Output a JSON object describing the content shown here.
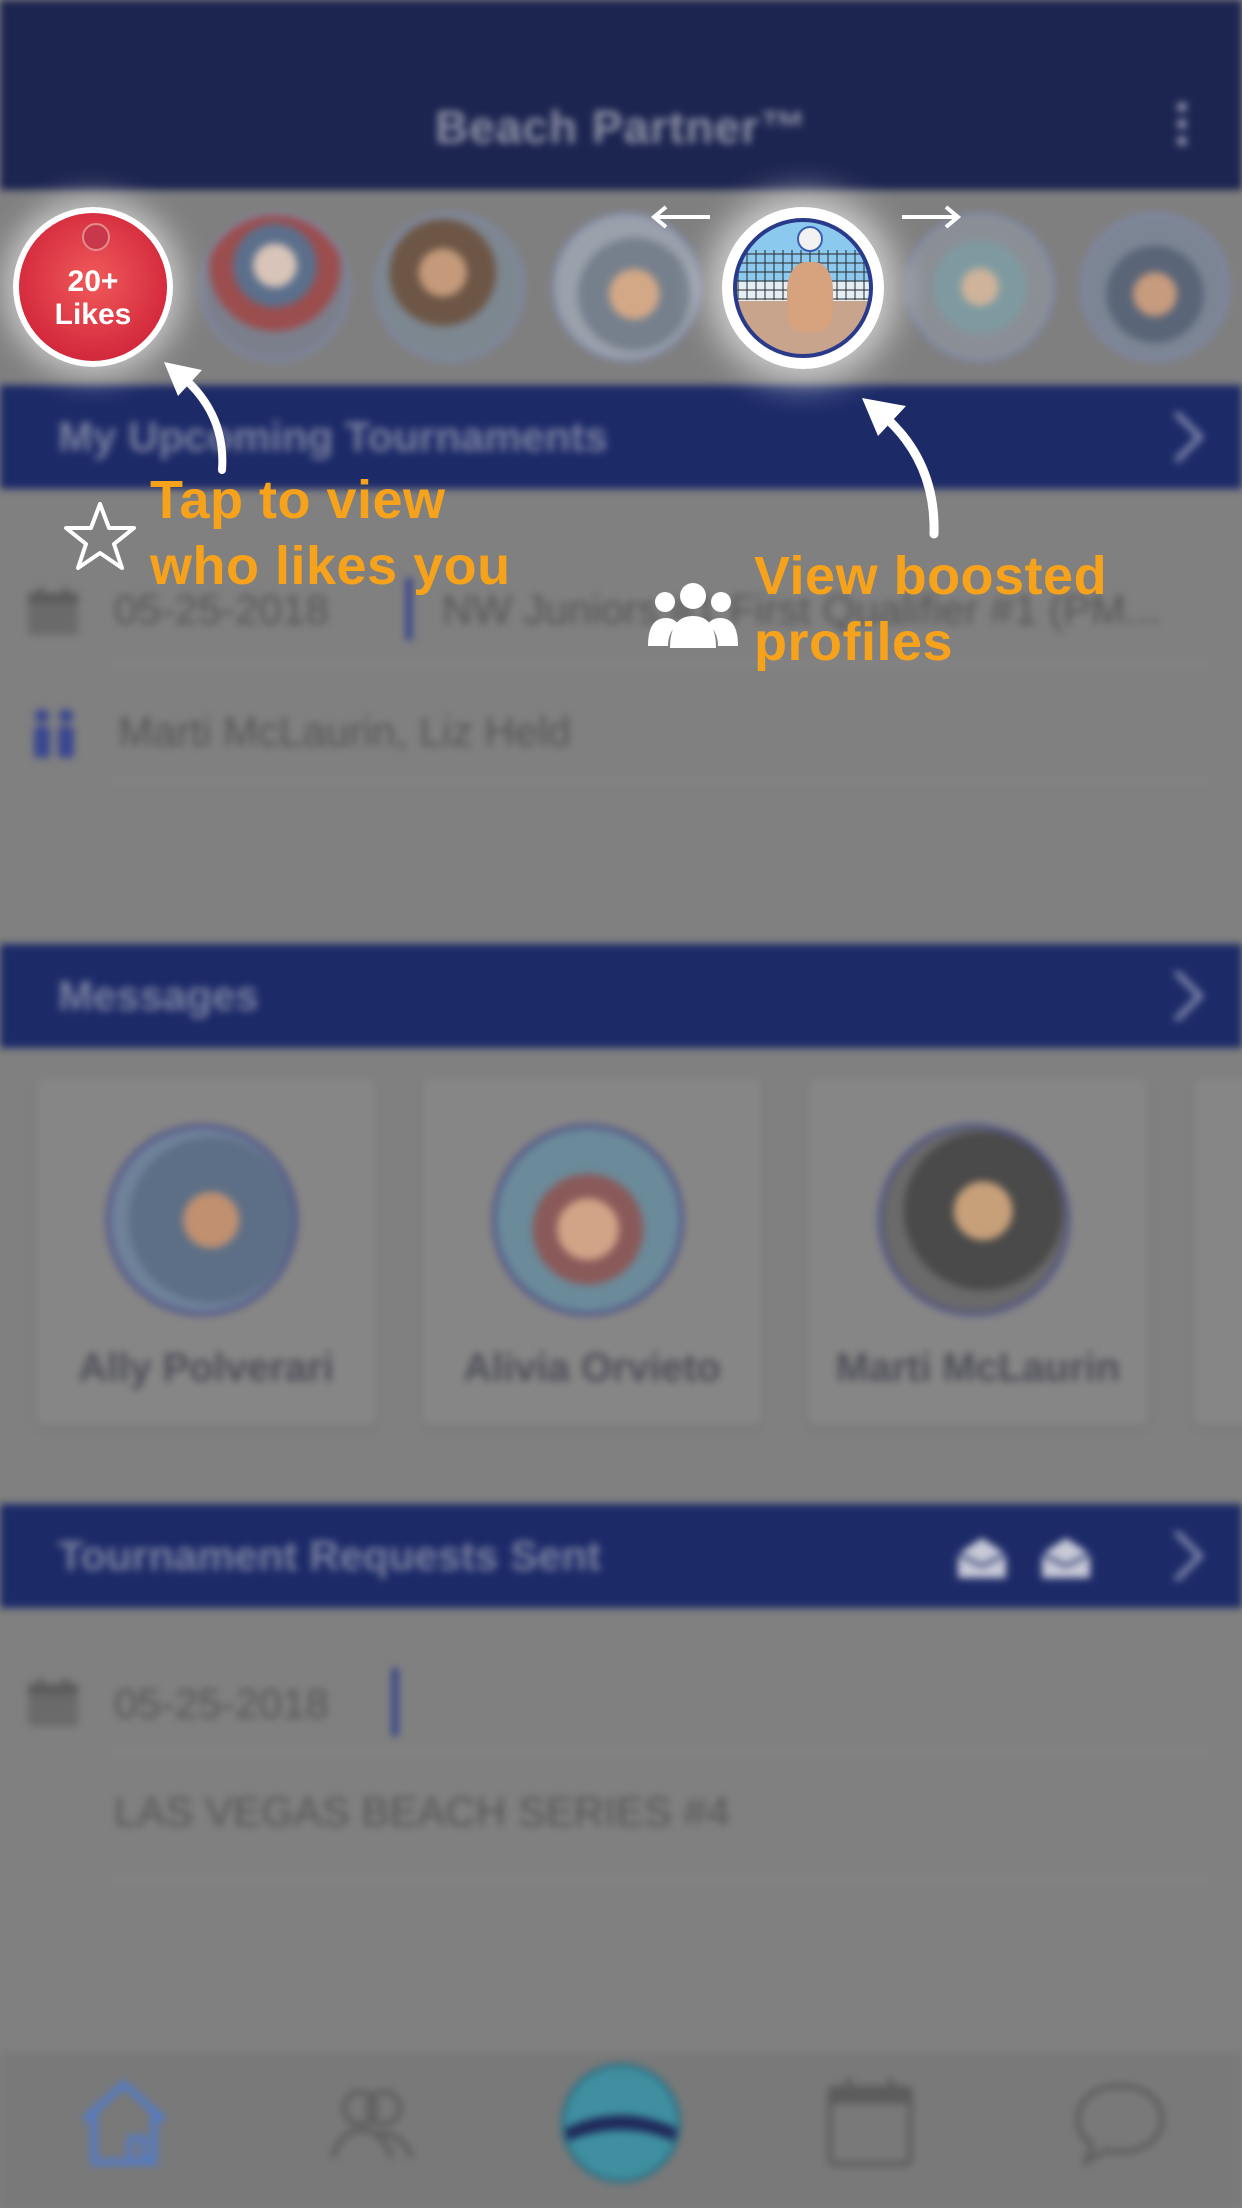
{
  "header": {
    "title": "Beach Partner™"
  },
  "likes": {
    "count": "20+",
    "label": "Likes"
  },
  "sections": {
    "tournaments": {
      "title": "My Upcoming Tournaments",
      "date": "05-25-2018",
      "name": "NW Juniors #1 First Qualifier #1 (PM...",
      "partners": "Marti McLaurin, Liz Held"
    },
    "messages": {
      "title": "Messages",
      "contacts": [
        {
          "name": "Ally Polverari"
        },
        {
          "name": "Alivia Orvieto"
        },
        {
          "name": "Marti McLaurin"
        }
      ]
    },
    "requests": {
      "title": "Tournament Requests Sent",
      "date": "05-25-2018",
      "name": "LAS VEGAS BEACH SERIES #4"
    }
  },
  "tutorial": {
    "likes_hint_line1": "Tap to view",
    "likes_hint_line2": "who likes you",
    "boost_hint_line1": "View boosted",
    "boost_hint_line2": "profiles"
  },
  "colors": {
    "header_bg": "#1c2450",
    "section_bg": "#1c2a68",
    "hint_text": "#f7a21b"
  },
  "icons": [
    "more-vert-icon",
    "chevron-right-icon",
    "calendar-icon",
    "partners-icon",
    "envelope-icon",
    "home-icon",
    "people-icon",
    "beach-ball-icon",
    "calendar-tab-icon",
    "chat-icon",
    "star-icon",
    "group-icon",
    "arrow-left-icon",
    "arrow-right-icon",
    "curved-arrow-icon"
  ]
}
